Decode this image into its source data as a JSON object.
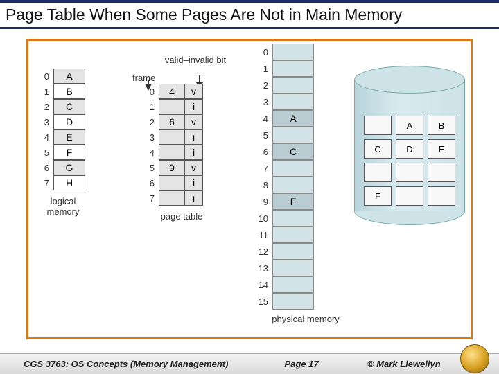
{
  "title": "Page Table When Some Pages Are Not in Main Memory",
  "logical_memory": {
    "caption": "logical memory",
    "entries": [
      {
        "index": "0",
        "page": "A"
      },
      {
        "index": "1",
        "page": "B"
      },
      {
        "index": "2",
        "page": "C"
      },
      {
        "index": "3",
        "page": "D"
      },
      {
        "index": "4",
        "page": "E"
      },
      {
        "index": "5",
        "page": "F"
      },
      {
        "index": "6",
        "page": "G"
      },
      {
        "index": "7",
        "page": "H"
      }
    ]
  },
  "page_table": {
    "caption": "page table",
    "frame_header": "frame",
    "bit_header": "valid–invalid bit",
    "entries": [
      {
        "index": "0",
        "frame": "4",
        "bit": "v"
      },
      {
        "index": "1",
        "frame": "",
        "bit": "i"
      },
      {
        "index": "2",
        "frame": "6",
        "bit": "v"
      },
      {
        "index": "3",
        "frame": "",
        "bit": "i"
      },
      {
        "index": "4",
        "frame": "",
        "bit": "i"
      },
      {
        "index": "5",
        "frame": "9",
        "bit": "v"
      },
      {
        "index": "6",
        "frame": "",
        "bit": "i"
      },
      {
        "index": "7",
        "frame": "",
        "bit": "i"
      }
    ]
  },
  "physical_memory": {
    "caption": "physical memory",
    "frames": [
      {
        "index": "0",
        "content": ""
      },
      {
        "index": "1",
        "content": ""
      },
      {
        "index": "2",
        "content": ""
      },
      {
        "index": "3",
        "content": ""
      },
      {
        "index": "4",
        "content": "A"
      },
      {
        "index": "5",
        "content": ""
      },
      {
        "index": "6",
        "content": "C"
      },
      {
        "index": "7",
        "content": ""
      },
      {
        "index": "8",
        "content": ""
      },
      {
        "index": "9",
        "content": "F"
      },
      {
        "index": "10",
        "content": ""
      },
      {
        "index": "11",
        "content": ""
      },
      {
        "index": "12",
        "content": ""
      },
      {
        "index": "13",
        "content": ""
      },
      {
        "index": "14",
        "content": ""
      },
      {
        "index": "15",
        "content": ""
      }
    ]
  },
  "disk": {
    "slots": [
      "",
      "A",
      "B",
      "C",
      "D",
      "E",
      "",
      "",
      "",
      "F",
      "",
      ""
    ]
  },
  "footer": {
    "course": "CGS 3763: OS Concepts  (Memory Management)",
    "page": "Page 17",
    "copyright": "© Mark Llewellyn"
  }
}
